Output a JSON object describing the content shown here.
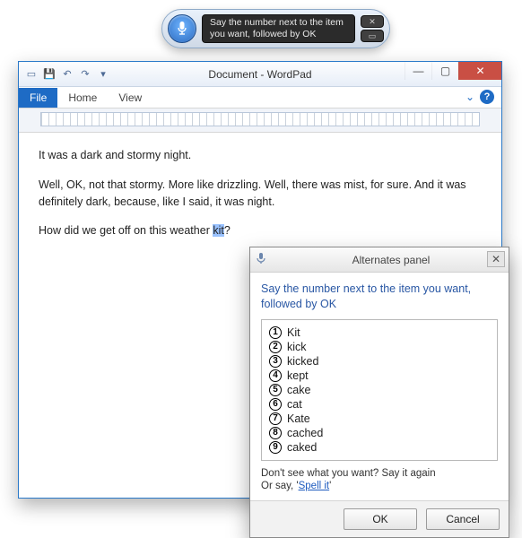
{
  "speech": {
    "message": "Say the number next to the item you want, followed by OK"
  },
  "window": {
    "title": "Document - WordPad",
    "tabs": {
      "file": "File",
      "home": "Home",
      "view": "View"
    }
  },
  "document": {
    "p1": "It was a dark and stormy night.",
    "p2": "Well, OK, not that stormy. More like drizzling. Well, there was mist, for sure. And it was definitely dark, because, like I said, it was night.",
    "p3_before": "How did we get off on this weather ",
    "p3_sel": "kit",
    "p3_after": "?"
  },
  "alternates": {
    "title": "Alternates panel",
    "prompt": "Say the number next to the item you want, followed by OK",
    "items": [
      "Kit",
      "kick",
      "kicked",
      "kept",
      "cake",
      "cat",
      "Kate",
      "cached",
      "caked"
    ],
    "footer1": "Don't see what you want? Say it again",
    "footer2_prefix": "Or say, '",
    "footer2_link": "Spell it",
    "footer2_suffix": "'",
    "ok": "OK",
    "cancel": "Cancel"
  }
}
